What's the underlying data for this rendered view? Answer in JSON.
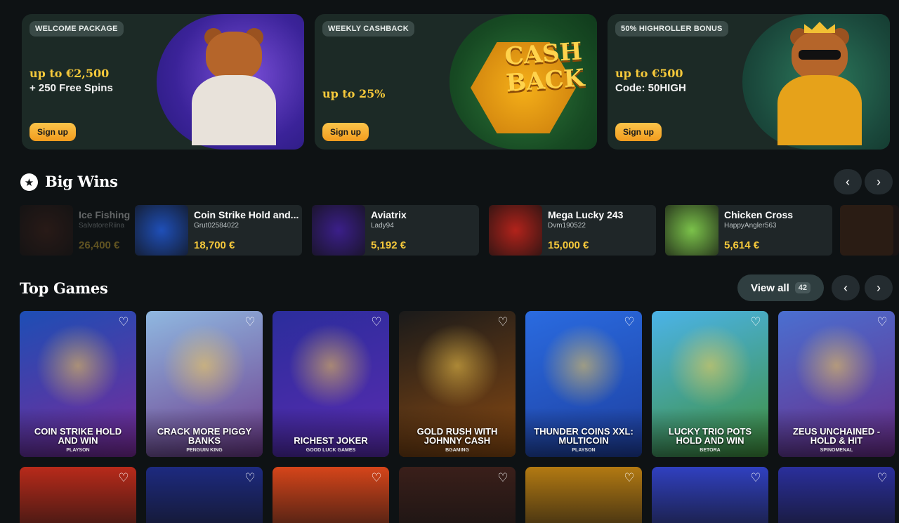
{
  "promos": [
    {
      "tag": "WELCOME PACKAGE",
      "line1": "up to €2,500",
      "line2": "+ 250 Free Spins",
      "cta": "Sign up"
    },
    {
      "tag": "WEEKLY CASHBACK",
      "line1": "up to 25%",
      "line2": "",
      "cta": "Sign up",
      "art_text": "CASH BACK"
    },
    {
      "tag": "50% HIGHROLLER BONUS",
      "line1": "up to €500",
      "line2": "Code: 50HIGH",
      "cta": "Sign up"
    }
  ],
  "big_wins": {
    "title": "Big Wins",
    "items": [
      {
        "game": "Ice Fishing",
        "user": "SalvatoreRiina",
        "amount": "26,400 €",
        "color": "#5a2a1e"
      },
      {
        "game": "Coin Strike Hold and...",
        "user": "Grut02584022",
        "amount": "18,700 €",
        "color": "#1f4fb8"
      },
      {
        "game": "Aviatrix",
        "user": "Lady94",
        "amount": "5,192 €",
        "color": "#3b1f8a"
      },
      {
        "game": "Mega Lucky 243",
        "user": "Dvm190522",
        "amount": "15,000 €",
        "color": "#b2231b"
      },
      {
        "game": "Chicken Cross",
        "user": "HappyAngler563",
        "amount": "5,614 €",
        "color": "#7bc24a"
      }
    ]
  },
  "top_games": {
    "title": "Top Games",
    "view_all": "View all",
    "count": "42",
    "games": [
      {
        "title": "COIN STRIKE HOLD AND WIN",
        "provider": "PLAYSON",
        "bg": "#1d4eb5",
        "bg2": "#7a2a9a"
      },
      {
        "title": "CRACK MORE PIGGY BANKS",
        "provider": "PENGUIN KING",
        "bg": "#8fb8e0",
        "bg2": "#6d3a8c"
      },
      {
        "title": "RICHEST JOKER",
        "provider": "GOOD LUCK GAMES",
        "bg": "#2b2d9c",
        "bg2": "#5a2bb0"
      },
      {
        "title": "GOLD RUSH WITH JOHNNY CASH",
        "provider": "BGAMING",
        "bg": "#1a1a1a",
        "bg2": "#8a4a12"
      },
      {
        "title": "THUNDER COINS XXL: MULTICOIN",
        "provider": "PLAYSON",
        "bg": "#2a6be0",
        "bg2": "#1e3fa0"
      },
      {
        "title": "LUCKY TRIO POTS HOLD AND WIN",
        "provider": "BETORA",
        "bg": "#4bb3e8",
        "bg2": "#3f8f3a"
      },
      {
        "title": "ZEUS UNCHAINED - HOLD & HIT",
        "provider": "SPINOMENAL",
        "bg": "#4a6fd0",
        "bg2": "#6a2c8a"
      }
    ],
    "row2_colors": [
      "#b82a1a",
      "#1d2a80",
      "#d6451a",
      "#3a1f1a",
      "#b37a12",
      "#3040c0",
      "#2a2f9c"
    ]
  }
}
